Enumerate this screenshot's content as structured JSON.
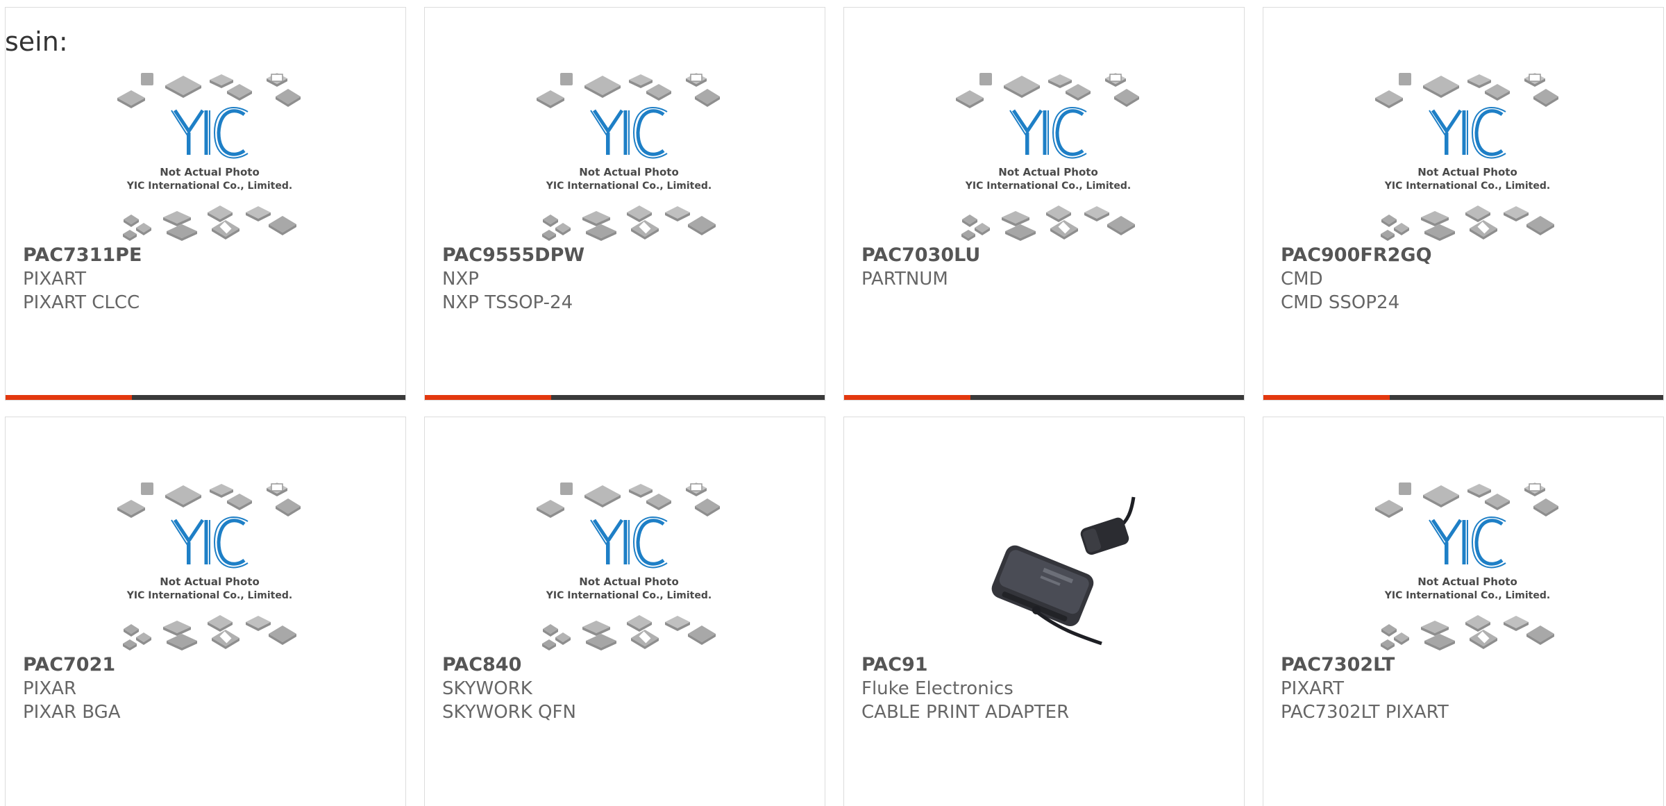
{
  "intro_text": "sein:",
  "colors": {
    "accent": "#e3380e",
    "bar": "#3a3a3a",
    "logo_blue": "#1e7fc6"
  },
  "placeholder": {
    "line1": "Not Actual Photo",
    "line2": "YIC International Co., Limited.",
    "logo": "YIC"
  },
  "products": [
    {
      "part": "PAC7311PE",
      "maker": "PIXART",
      "desc": "PIXART CLCC",
      "image": "placeholder-icon"
    },
    {
      "part": "PAC9555DPW",
      "maker": "NXP",
      "desc": "NXP TSSOP-24",
      "image": "placeholder-icon"
    },
    {
      "part": "PAC7030LU",
      "maker": "PARTNUM",
      "desc": "",
      "image": "placeholder-icon"
    },
    {
      "part": "PAC900FR2GQ",
      "maker": "CMD",
      "desc": "CMD SSOP24",
      "image": "placeholder-icon"
    },
    {
      "part": "PAC7021",
      "maker": "PIXAR",
      "desc": "PIXAR BGA",
      "image": "placeholder-icon"
    },
    {
      "part": "PAC840",
      "maker": "SKYWORK",
      "desc": "SKYWORK QFN",
      "image": "placeholder-icon"
    },
    {
      "part": "PAC91",
      "maker": "Fluke Electronics",
      "desc": "CABLE PRINT ADAPTER",
      "image": "adapter-photo"
    },
    {
      "part": "PAC7302LT",
      "maker": "PIXART",
      "desc": "PAC7302LT PIXART",
      "image": "placeholder-icon"
    }
  ]
}
